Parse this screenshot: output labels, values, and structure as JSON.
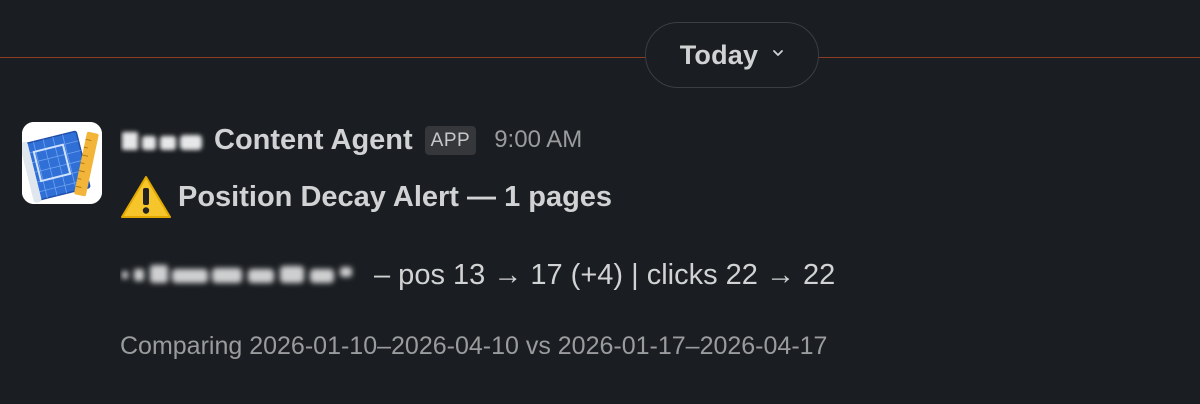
{
  "date_divider": {
    "label": "Today",
    "line_color": "#8a3b22"
  },
  "message": {
    "avatar_icon": "blueprint-ruler-icon",
    "sender_name": "Content Agent",
    "app_badge": "APP",
    "timestamp": "9:00 AM",
    "title_icon": "warning-icon",
    "title": "Position Decay Alert — 1 pages",
    "detail": "– pos 13 → 17 (+4) | clicks 22 → 22",
    "comparison": "Comparing 2026-01-10–2026-04-10 vs 2026-01-17–2026-04-17"
  },
  "colors": {
    "background": "#1a1d21",
    "text_primary": "#d1d2d3",
    "text_secondary": "#9a9b9d",
    "badge_bg": "#35373b",
    "warning_yellow": "#f5c52b"
  }
}
